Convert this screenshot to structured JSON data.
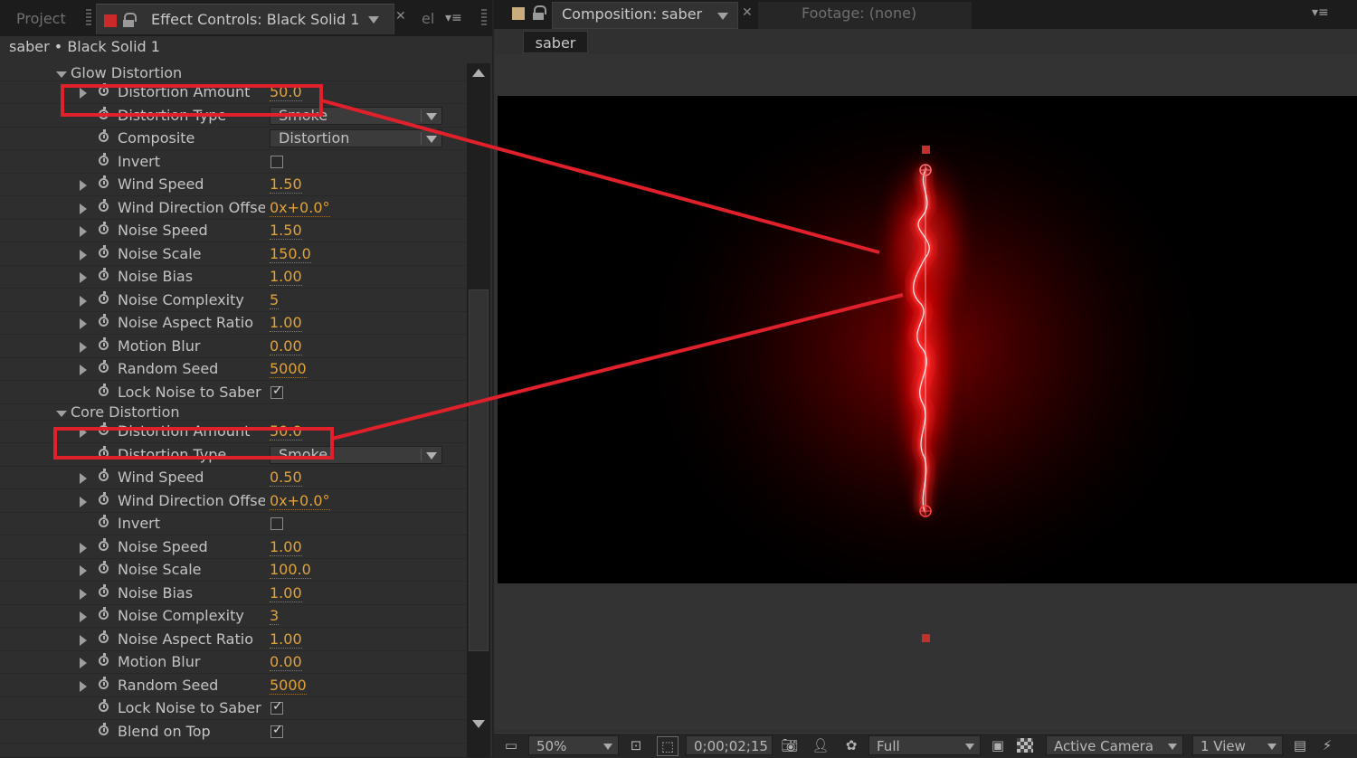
{
  "left_panel": {
    "tabs": {
      "project": "Project",
      "effect_controls": "Effect Controls: Black Solid 1",
      "truncated": "el"
    },
    "path": "saber • Black Solid 1",
    "groups": [
      {
        "name": "Glow Distortion",
        "properties": [
          {
            "label": "Distortion Amount",
            "value": "50.0",
            "kind": "value",
            "expandable": true
          },
          {
            "label": "Distortion Type",
            "value": "Smoke",
            "kind": "dropdown",
            "expandable": false
          },
          {
            "label": "Composite",
            "value": "Distortion",
            "kind": "dropdown",
            "expandable": false
          },
          {
            "label": "Invert",
            "value": "",
            "kind": "checkbox",
            "expandable": false
          },
          {
            "label": "Wind Speed",
            "value": "1.50",
            "kind": "value",
            "expandable": true
          },
          {
            "label": "Wind Direction Offset",
            "value": "0x+0.0°",
            "kind": "value",
            "expandable": true
          },
          {
            "label": "Noise Speed",
            "value": "1.50",
            "kind": "value",
            "expandable": true
          },
          {
            "label": "Noise Scale",
            "value": "150.0",
            "kind": "value",
            "expandable": true
          },
          {
            "label": "Noise Bias",
            "value": "1.00",
            "kind": "value",
            "expandable": true
          },
          {
            "label": "Noise Complexity",
            "value": "5",
            "kind": "value",
            "expandable": true
          },
          {
            "label": "Noise Aspect Ratio",
            "value": "1.00",
            "kind": "value",
            "expandable": true
          },
          {
            "label": "Motion Blur",
            "value": "0.00",
            "kind": "value",
            "expandable": true
          },
          {
            "label": "Random Seed",
            "value": "5000",
            "kind": "value",
            "expandable": true
          },
          {
            "label": "Lock Noise to Saber",
            "value": "✓",
            "kind": "checkbox",
            "expandable": false
          }
        ]
      },
      {
        "name": "Core Distortion",
        "properties": [
          {
            "label": "Distortion Amount",
            "value": "50.0",
            "kind": "value",
            "expandable": true
          },
          {
            "label": "Distortion Type",
            "value": "Smoke",
            "kind": "dropdown",
            "expandable": false
          },
          {
            "label": "Wind Speed",
            "value": "0.50",
            "kind": "value",
            "expandable": true
          },
          {
            "label": "Wind Direction Offset",
            "value": "0x+0.0°",
            "kind": "value",
            "expandable": true
          },
          {
            "label": "Invert",
            "value": "",
            "kind": "checkbox",
            "expandable": false
          },
          {
            "label": "Noise Speed",
            "value": "1.00",
            "kind": "value",
            "expandable": true
          },
          {
            "label": "Noise Scale",
            "value": "100.0",
            "kind": "value",
            "expandable": true
          },
          {
            "label": "Noise Bias",
            "value": "1.00",
            "kind": "value",
            "expandable": true
          },
          {
            "label": "Noise Complexity",
            "value": "3",
            "kind": "value",
            "expandable": true
          },
          {
            "label": "Noise Aspect Ratio",
            "value": "1.00",
            "kind": "value",
            "expandable": true
          },
          {
            "label": "Motion Blur",
            "value": "0.00",
            "kind": "value",
            "expandable": true
          },
          {
            "label": "Random Seed",
            "value": "5000",
            "kind": "value",
            "expandable": true
          },
          {
            "label": "Lock Noise to Saber",
            "value": "✓",
            "kind": "checkbox",
            "expandable": false
          },
          {
            "label": "Blend on Top",
            "value": "✓",
            "kind": "checkbox",
            "expandable": false
          }
        ]
      }
    ]
  },
  "right_panel": {
    "tabs": {
      "composition": "Composition: saber",
      "footage": "Footage: (none)"
    },
    "comp_name": "saber",
    "bottom_bar": {
      "zoom": "50%",
      "timecode": "0;00;02;15",
      "resolution": "Full",
      "camera": "Active Camera",
      "views": "1 View"
    }
  },
  "colors": {
    "highlight_box": "#e0202a",
    "value_orange": "#e0a33a",
    "saber_red": "#ff1a1a"
  },
  "icons": [
    "stopwatch-icon",
    "lock-icon",
    "panel-menu-icon",
    "camera-icon",
    "channel-icon",
    "region-of-interest-icon",
    "transparency-grid-icon"
  ]
}
